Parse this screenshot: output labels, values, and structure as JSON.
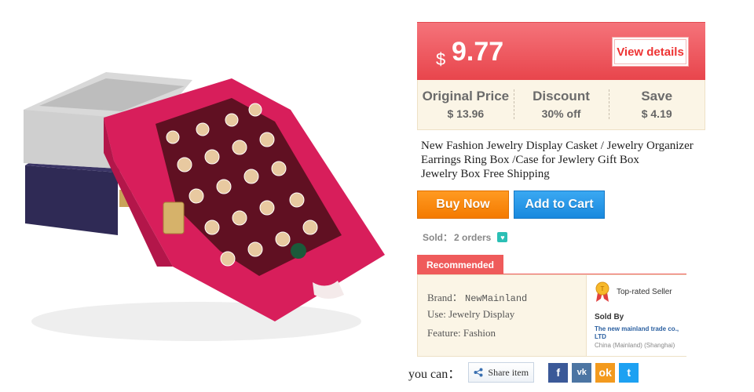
{
  "price": {
    "currency": "$",
    "value": "9.77",
    "view_details": "View details"
  },
  "price_details": [
    {
      "label": "Original Price",
      "currency": "$",
      "value": "13.96"
    },
    {
      "label": "Discount",
      "currency": "",
      "value": "30% off"
    },
    {
      "label": "Save",
      "currency": "$",
      "value": "4.19"
    }
  ],
  "title_lines": [
    "New Fashion Jewelry Display Casket / Jewelry Organizer",
    "Earrings Ring Box /Case for Jewlery Gift Box",
    "Jewelry Box Free Shipping"
  ],
  "buttons": {
    "buy_now": "Buy Now",
    "add_to_cart": "Add to Cart"
  },
  "sold": {
    "label": "Sold：",
    "count": "2 orders"
  },
  "recommended": {
    "tab": "Recommended",
    "specs": [
      {
        "label": "Brand：",
        "value": "NewMainland"
      },
      {
        "label": "Use:",
        "value": "Jewelry Display"
      },
      {
        "label": "Feature:",
        "value": "Fashion"
      }
    ],
    "seller": {
      "badge": "Top-rated Seller",
      "sold_by": "Sold By",
      "name": "The new mainland trade co., LTD",
      "location": "China (Mainland) (Shanghai)"
    }
  },
  "share": {
    "prefix": "you can：",
    "share_item": "Share item",
    "networks": [
      {
        "name": "facebook-icon",
        "glyph": "f"
      },
      {
        "name": "vk-icon",
        "glyph": "vk"
      },
      {
        "name": "odnoklassniki-icon",
        "glyph": "ok"
      },
      {
        "name": "twitter-icon",
        "glyph": "t"
      }
    ]
  },
  "colors": {
    "price_banner": "#e8454c",
    "buy_now": "#f47a00",
    "add_to_cart": "#1989de",
    "recommended": "#ef5b5b",
    "panel_bg": "#fbf5e6"
  }
}
